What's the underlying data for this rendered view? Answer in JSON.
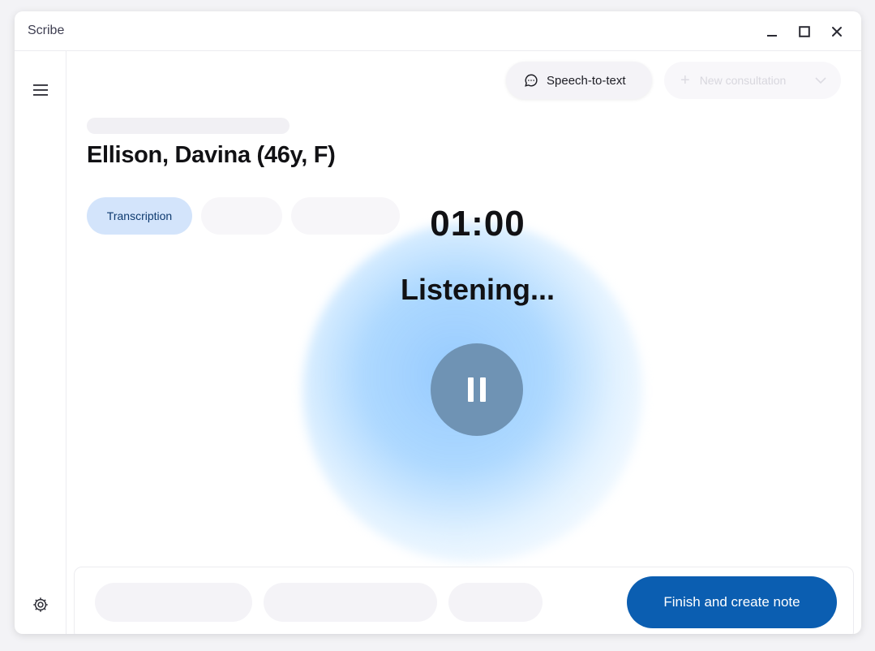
{
  "window": {
    "title": "Scribe"
  },
  "toolbar": {
    "speech_to_text_label": "Speech-to-text",
    "new_consultation_label": "New consultation"
  },
  "patient": {
    "name": "Ellison, Davina (46y, F)"
  },
  "tabs": [
    {
      "label": "Transcription",
      "active": true
    }
  ],
  "recording": {
    "timer": "01:00",
    "status": "Listening..."
  },
  "footer": {
    "finish_label": "Finish and create note"
  },
  "colors": {
    "accent": "#0b5eb1",
    "active_tab_bg": "#d3e4fb",
    "pause_button": "#6f93b4",
    "glow": "#91c8ff"
  },
  "icons": {
    "menu": "hamburger-icon",
    "settings": "gear-icon",
    "speech": "chat-bubble-icon",
    "pause": "pause-icon"
  }
}
